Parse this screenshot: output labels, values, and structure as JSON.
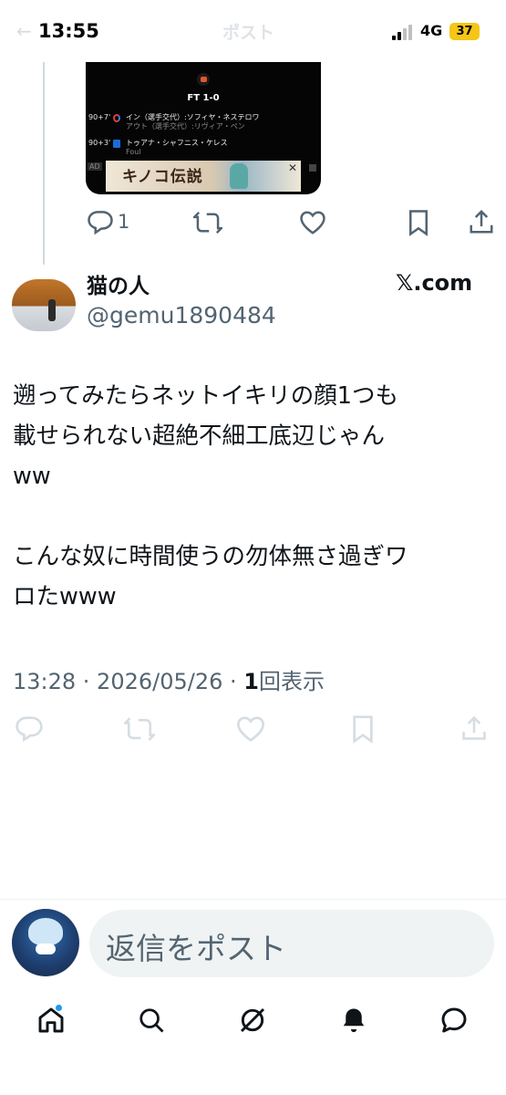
{
  "status_bar": {
    "time": "13:55",
    "network": "4G",
    "battery": "37",
    "battery_color": "#f5c518",
    "faded_back_glyph": "←",
    "faded_title": "ポスト"
  },
  "quoted_media": {
    "score": "FT 1-0",
    "events": [
      {
        "minute": "90+7'",
        "icon": "substitution-icon",
        "line1": "イン（選手交代）:ソフィヤ・ネステロワ",
        "line2": "アウト（選手交代）:リヴィア・ペン"
      },
      {
        "minute": "90+3'",
        "icon": "card-icon",
        "line1": "トゥアナ・シャフニス・ケレス",
        "line2": "Foul"
      }
    ],
    "ad_label": "AD",
    "ad_banner_text": "キノコ伝説",
    "ad_close": "✕"
  },
  "previous_post_actions": {
    "reply_count": "1",
    "icons": [
      "reply-icon",
      "repost-icon",
      "like-icon",
      "bookmark-icon",
      "share-icon"
    ]
  },
  "post": {
    "author_name": "猫の人",
    "author_handle": "@gemu1890484",
    "source_label": "𝕏.com",
    "body": "遡ってみたらネットイキリの顔1つも\n載せられない超絶不細工底辺じゃん\nww\n\nこんな奴に時間使うの勿体無さ過ぎワ\nロたwww",
    "meta_time": "13:28 · 2026/05/26 · ",
    "meta_views_count": "1",
    "meta_views_label": "回表示"
  },
  "post_actions": {
    "icons": [
      "reply-icon",
      "repost-icon",
      "like-icon",
      "bookmark-icon",
      "share-icon"
    ],
    "color": "#d5dde2"
  },
  "reply_bar": {
    "placeholder": "返信をポスト"
  },
  "bottom_nav": {
    "items": [
      "home-icon",
      "search-icon",
      "grok-icon",
      "notifications-icon",
      "messages-icon"
    ],
    "notification_dot_color": "#1d9bf0"
  }
}
